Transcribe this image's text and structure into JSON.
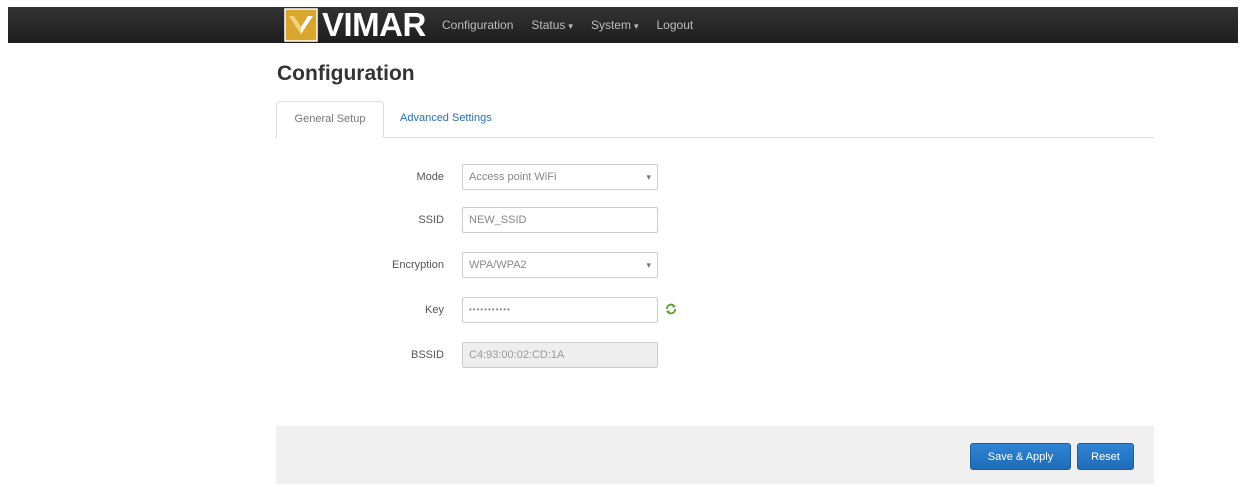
{
  "navbar": {
    "brand": "VIMAR",
    "items": [
      {
        "label": "Configuration",
        "has_menu": false
      },
      {
        "label": "Status",
        "has_menu": true
      },
      {
        "label": "System",
        "has_menu": true
      },
      {
        "label": "Logout",
        "has_menu": false
      }
    ]
  },
  "page": {
    "title": "Configuration"
  },
  "tabs": {
    "active": "General Setup",
    "other": "Advanced Settings"
  },
  "form": {
    "mode": {
      "label": "Mode",
      "value": "Access point WiFi"
    },
    "ssid": {
      "label": "SSID",
      "value": "NEW_SSID"
    },
    "encryption": {
      "label": "Encryption",
      "value": "WPA/WPA2"
    },
    "key": {
      "label": "Key",
      "value": "•••••••••••"
    },
    "bssid": {
      "label": "BSSID",
      "value": "C4:93:00:02:CD:1A"
    }
  },
  "actions": {
    "save_apply": "Save & Apply",
    "reset": "Reset"
  },
  "colors": {
    "navbar": "#222222",
    "primary_button": "#2679c6",
    "link": "#2a6fb0",
    "key_toggle": "#5aa02c",
    "logo_gold": "#d9a62e"
  },
  "icons": {
    "brand_logo": "vimar-logo-icon",
    "key_toggle": "reveal-password-icon"
  }
}
